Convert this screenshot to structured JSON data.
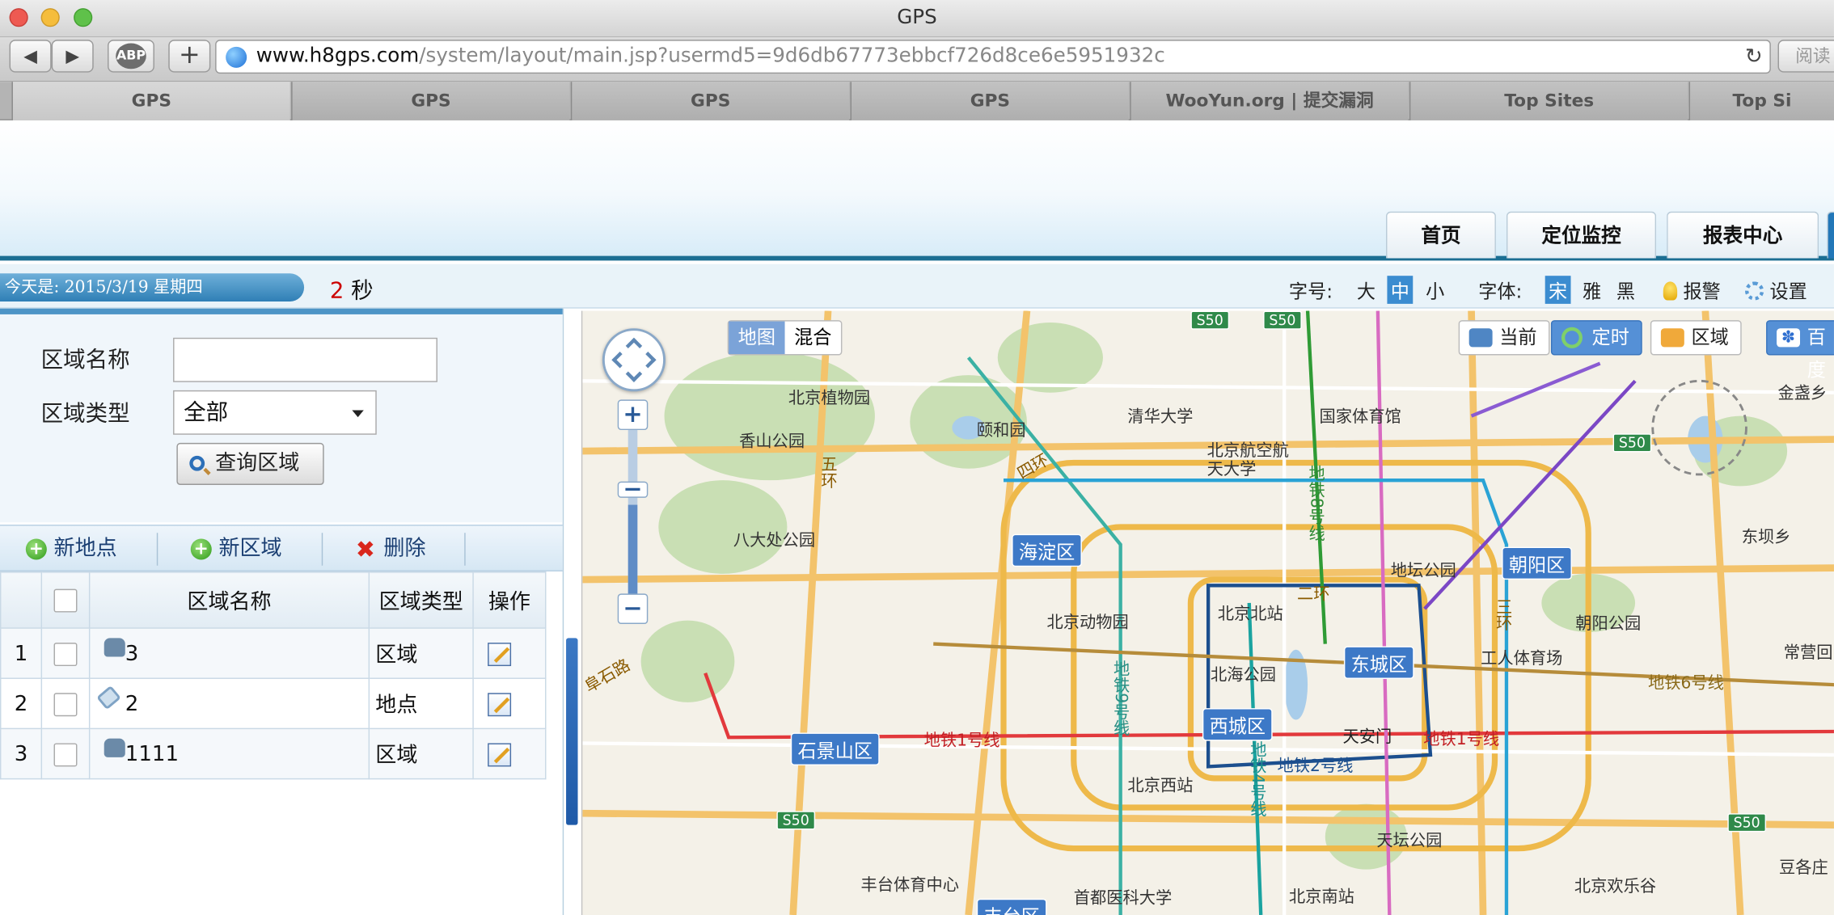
{
  "window": {
    "title": "GPS"
  },
  "browser": {
    "url_host": "www.h8gps.com",
    "url_path": "/system/layout/main.jsp?usermd5=9d6db67773ebbcf726d8ce6e5951932c",
    "back": "◀",
    "forward": "▶",
    "abp": "ABP",
    "new_tab": "+",
    "reader": "阅读",
    "reload": "↻",
    "tabs": [
      "GPS",
      "GPS",
      "GPS",
      "GPS",
      "WooYun.org | 提交漏洞",
      "Top Sites",
      "Top Si"
    ]
  },
  "nav": {
    "home": "首页",
    "monitor": "定位监控",
    "reports": "报表中心"
  },
  "info": {
    "date_label": "今天是:  2015/3/19 星期四",
    "seconds_num": "2",
    "seconds_unit": "秒",
    "font_size_label": "字号:",
    "size_large": "大",
    "size_medium": "中",
    "size_small": "小",
    "font_face_label": "字体:",
    "font_song": "宋",
    "font_ya": "雅",
    "font_hei": "黑",
    "alarm": "报警",
    "settings": "设置"
  },
  "filter": {
    "area_name_label": "区域名称",
    "area_name_value": "",
    "area_type_label": "区域类型",
    "area_type_value": "全部",
    "query_button": "查询区域"
  },
  "actions": {
    "new_point": "新地点",
    "new_area": "新区域",
    "delete": "删除"
  },
  "table": {
    "headers": {
      "name": "区域名称",
      "type": "区域类型",
      "op": "操作"
    },
    "rows": [
      {
        "index": "1",
        "name": "3",
        "type": "区域",
        "kind": "area"
      },
      {
        "index": "2",
        "name": "2",
        "type": "地点",
        "kind": "point"
      },
      {
        "index": "3",
        "name": "1111",
        "type": "区域",
        "kind": "area"
      }
    ]
  },
  "map": {
    "type_map": "地图",
    "type_hybrid": "混合",
    "ctl_current": "当前",
    "ctl_timed": "定时",
    "ctl_area": "区域",
    "ctl_baidu": "百度",
    "districts": {
      "haidian": "海淀区",
      "chaoyang": "朝阳区",
      "dongcheng": "东城区",
      "xicheng": "西城区",
      "shijingshan": "石景山区",
      "fengtai": "丰台区"
    },
    "places": {
      "botanical": "北京植物园",
      "yiheyuan": "颐和园",
      "xiangshan": "香山公园",
      "badachu": "八大处公园",
      "tsinghua": "清华大学",
      "stadium": "国家体育馆",
      "buaa": "北京航空航天大学",
      "zoo": "北京动物园",
      "north_station": "北京北站",
      "beihai": "北海公园",
      "ditan": "地坛公园",
      "chaoyang_park": "朝阳公园",
      "workers": "工人体育场",
      "tiananmen": "天安门",
      "west_station": "北京西站",
      "tiantan": "天坛公园",
      "south_station": "北京南站",
      "fengtai_sports": "丰台体育中心",
      "medical": "首都医科大学",
      "happy_valley": "北京欢乐谷",
      "jinzhan": "金盏乡",
      "dongba": "东坝乡",
      "changying": "常营回",
      "doujiazhuang": "豆各庄",
      "fushi_road": "阜石路"
    },
    "roads": {
      "ring2": "二环",
      "ring3": "三环",
      "ring4": "四环",
      "ring5": "五环",
      "line1a": "地铁1号线",
      "line1b": "地铁1号线",
      "line2": "地铁2号线",
      "line4": "地铁4号线",
      "line6": "地铁6号线",
      "line8": "地铁8号线",
      "line9": "地铁9号线",
      "s50": "S50"
    }
  }
}
